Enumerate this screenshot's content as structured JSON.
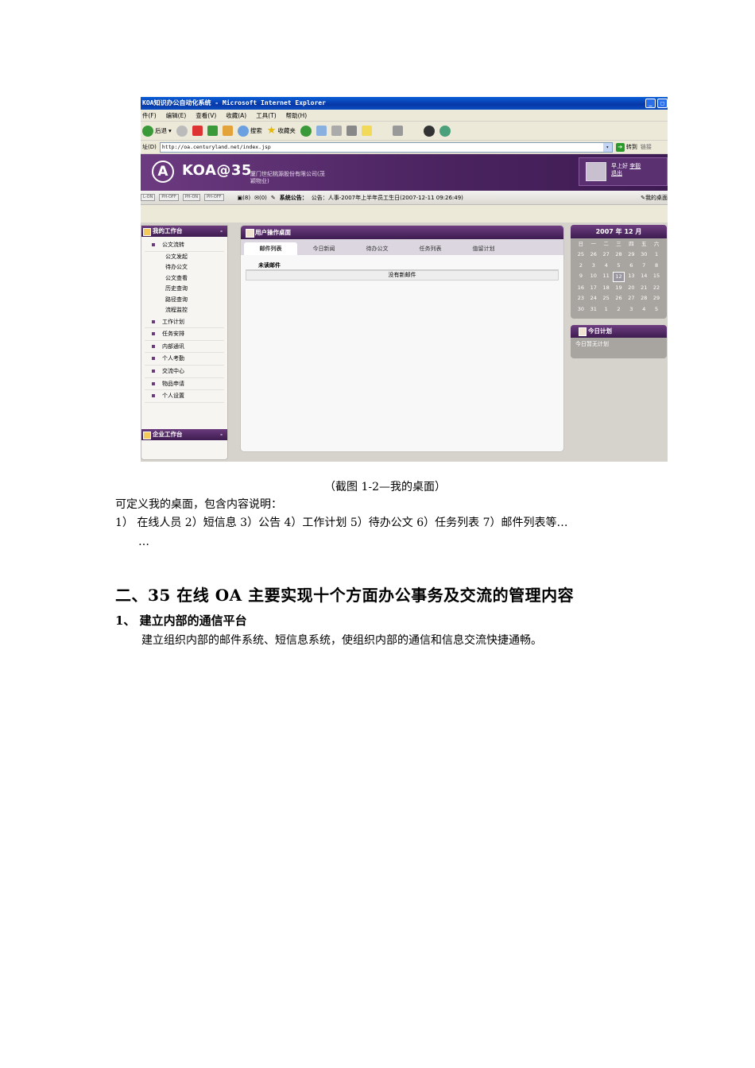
{
  "screenshot": {
    "window_title": "KOA知识办公自动化系统 - Microsoft Internet Explorer",
    "window_buttons": [
      "_",
      "□"
    ],
    "menu": [
      "件(F)",
      "编辑(E)",
      "查看(V)",
      "收藏(A)",
      "工具(T)",
      "帮助(H)"
    ],
    "toolbar": {
      "back": "后退",
      "search": "搜索",
      "favorites": "收藏夹"
    },
    "address": {
      "label": "址(D)",
      "url": "http://oa.centuryland.net/index.jsp",
      "go": "转到",
      "links": "链接"
    },
    "banner": {
      "logo_letter": "A",
      "logo_text": "KOA@35",
      "company": "厦门世纪桃源股份有限公司(茂颖物业)",
      "greeting": "早上好",
      "user": "李毅",
      "logout": "退出"
    },
    "statusbar": {
      "chips": [
        "L-ON",
        "PH-OFF",
        "PH-ON",
        "PH-OFF"
      ],
      "messages": "(8)",
      "mail": "(0)",
      "notice_label": "系统公告：",
      "notice_text": "公告：人事-2007年上半年员工生日(2007-12-11 09:26:49)",
      "my_desktop": "我的桌面"
    },
    "sidebar": {
      "title": "我的工作台",
      "collapse": "-",
      "group": "公文流转",
      "sub_items": [
        "公文发起",
        "待办公文",
        "公文查看",
        "历史查询",
        "路径查询",
        "流程监控"
      ],
      "items": [
        "工作计划",
        "任务安排",
        "内部通讯",
        "个人考勤",
        "交流中心",
        "物品申请",
        "个人设置"
      ],
      "enterprise_title": "企业工作台"
    },
    "desk": {
      "title": "用户操作桌面",
      "tabs": [
        "邮件列表",
        "今日新闻",
        "待办公文",
        "任务列表",
        "值留计划"
      ],
      "unread_title": "未读邮件",
      "no_mail": "没有新邮件"
    },
    "calendar": {
      "title": "2007 年 12 月",
      "weekdays": [
        "日",
        "一",
        "二",
        "三",
        "四",
        "五",
        "六"
      ],
      "days": [
        "25",
        "26",
        "27",
        "28",
        "29",
        "30",
        "1",
        "2",
        "3",
        "4",
        "5",
        "6",
        "7",
        "8",
        "9",
        "10",
        "11",
        "12",
        "13",
        "14",
        "15",
        "16",
        "17",
        "18",
        "19",
        "20",
        "21",
        "22",
        "23",
        "24",
        "25",
        "26",
        "27",
        "28",
        "29",
        "30",
        "31",
        "1",
        "2",
        "3",
        "4",
        "5"
      ],
      "today": "12"
    },
    "plan": {
      "title": "今日计划",
      "body": "今日暂无计划"
    }
  },
  "document": {
    "caption": "（截图 1-2—我的桌面）",
    "intro": "可定义我的桌面，包含内容说明：",
    "list_line": "1） 在线人员 2）短信息 3）公告 4）工作计划 5）待办公文 6）任务列表 7）邮件列表等…",
    "list_cont": "…",
    "heading": "二、35 在线 OA 主要实现十个方面办公事务及交流的管理内容",
    "subheading": "1、 建立内部的通信平台",
    "body": "建立组织内部的邮件系统、短信息系统，使组织内部的通信和信息交流快捷通畅。"
  }
}
